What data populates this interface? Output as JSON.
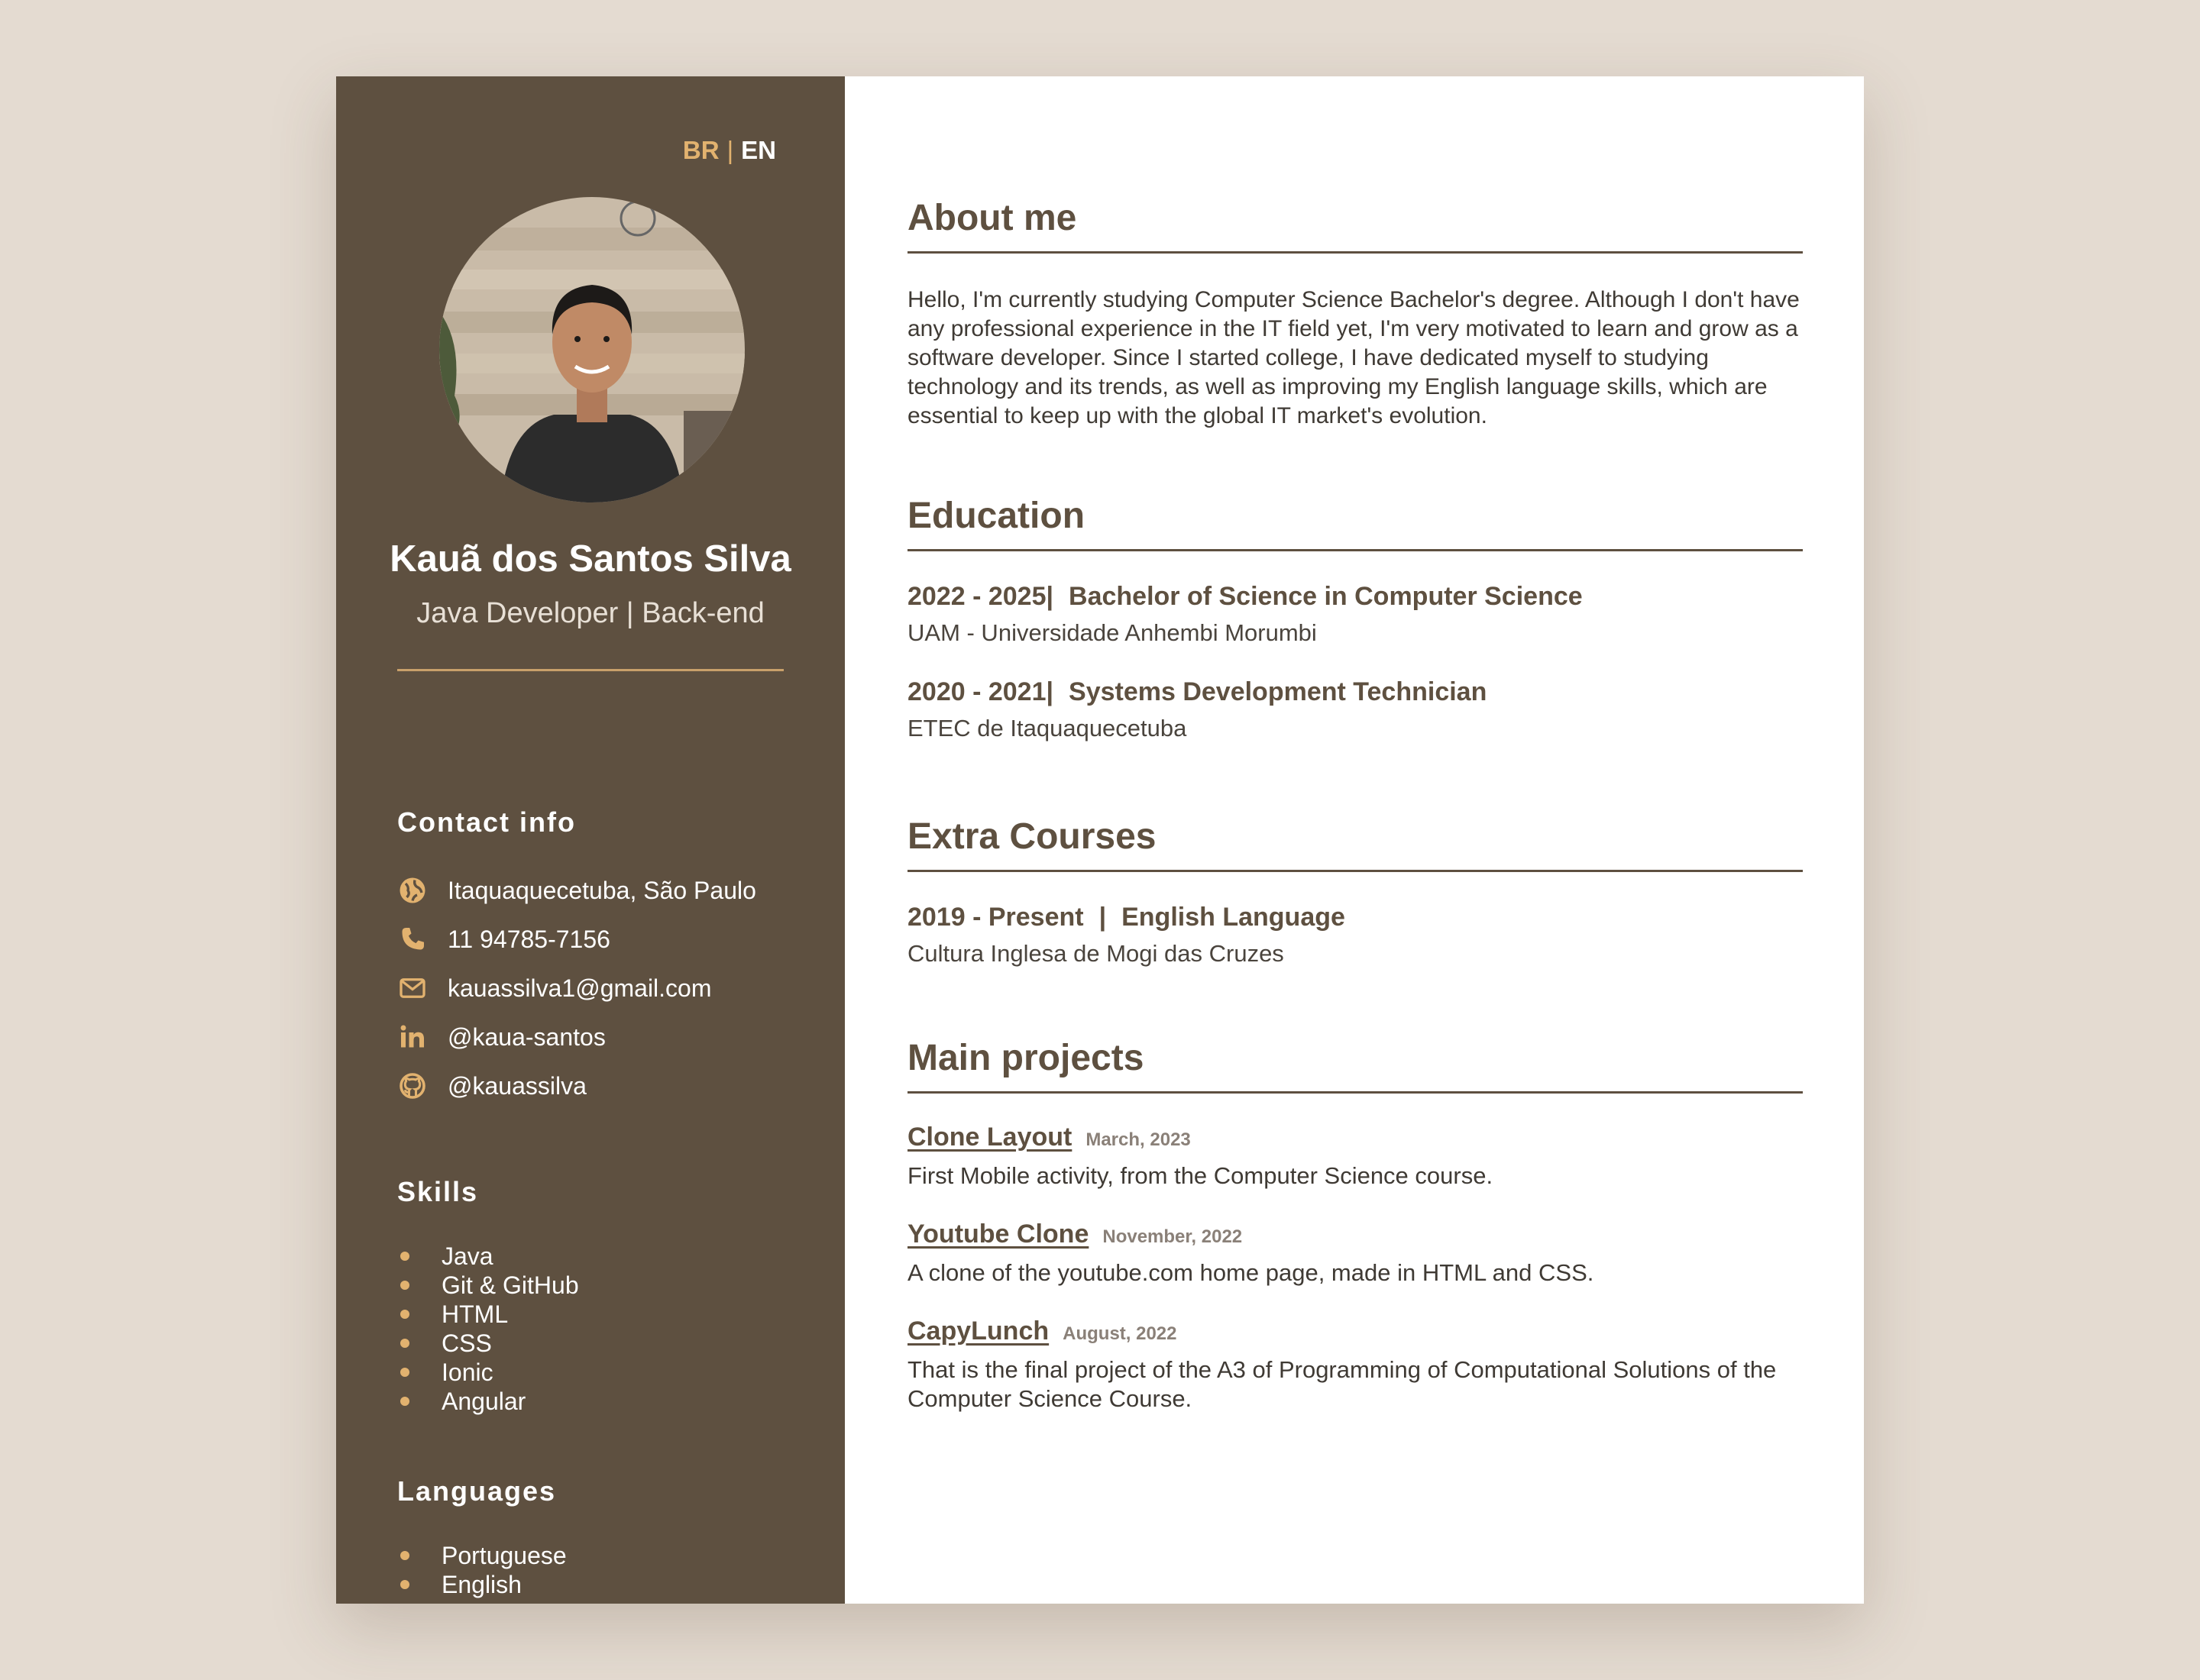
{
  "sidebar": {
    "lang": {
      "br": "BR",
      "sep": "|",
      "en": "EN"
    },
    "name": "Kauã dos Santos Silva",
    "role": "Java Developer | Back-end",
    "contact_title": "Contact info",
    "contacts": [
      {
        "icon": "globe-icon",
        "text": "Itaquaquecetuba, São Paulo"
      },
      {
        "icon": "phone-icon",
        "text": "11 94785-7156"
      },
      {
        "icon": "mail-icon",
        "text": "kauassilva1@gmail.com"
      },
      {
        "icon": "linkedin-icon",
        "text": "@kaua-santos"
      },
      {
        "icon": "github-icon",
        "text": "@kauassilva"
      }
    ],
    "skills_title": "Skills",
    "skills": [
      "Java",
      "Git & GitHub",
      "HTML",
      "CSS",
      "Ionic",
      "Angular"
    ],
    "languages_title": "Languages",
    "languages": [
      "Portuguese",
      "English"
    ]
  },
  "main": {
    "about": {
      "title": "About me",
      "text": "Hello, I'm currently studying Computer Science Bachelor's degree. Although I don't have any professional experience in the IT field yet, I'm very motivated to learn and grow as a software developer. Since I started college, I have dedicated myself to studying technology and its trends, as well as improving my English language skills, which are essential to keep up with the global IT market's evolution."
    },
    "education": {
      "title": "Education",
      "items": [
        {
          "period": "2022 - 2025|",
          "degree": "Bachelor of Science in Computer Science",
          "school": "UAM - Universidade Anhembi Morumbi"
        },
        {
          "period": "2020 - 2021|",
          "degree": "Systems Development Technician",
          "school": "ETEC de Itaquaquecetuba"
        }
      ]
    },
    "extra": {
      "title": "Extra Courses",
      "items": [
        {
          "period": "2019 - Present",
          "sep": "|",
          "course": "English Language",
          "school": "Cultura Inglesa de Mogi das Cruzes"
        }
      ]
    },
    "projects": {
      "title": "Main projects",
      "items": [
        {
          "name": "Clone Layout",
          "date": "March, 2023",
          "desc": "First Mobile activity, from the Computer Science course."
        },
        {
          "name": "Youtube Clone",
          "date": "November, 2022",
          "desc": "A clone of the youtube.com home page, made in HTML and CSS."
        },
        {
          "name": "CapyLunch",
          "date": "August, 2022",
          "desc": "That is the final project of the A3 of Programming of Computational Solutions of the Computer Science Course."
        }
      ]
    }
  },
  "colors": {
    "sidebar_bg": "#5e5040",
    "accent": "#e2b26f",
    "page_bg": "#e4dbd1",
    "text_dark": "#5e5040"
  }
}
